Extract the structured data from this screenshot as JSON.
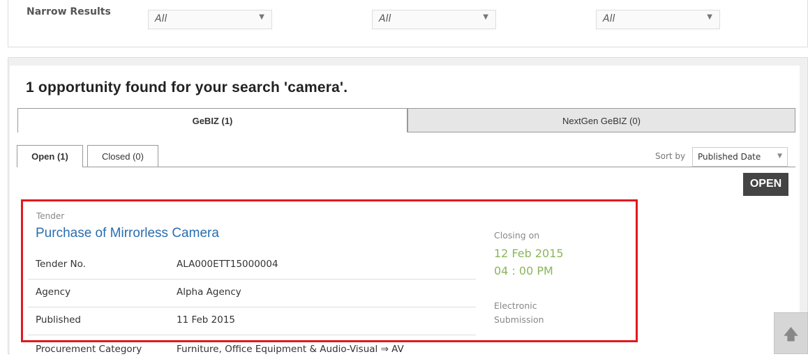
{
  "narrow": {
    "label": "Narrow Results",
    "filters": [
      {
        "value": "All"
      },
      {
        "value": "All"
      },
      {
        "value": "All"
      }
    ]
  },
  "results": {
    "summary": "1 opportunity found for your search 'camera'."
  },
  "source_tabs": [
    {
      "label": "GeBIZ (1)",
      "active": true
    },
    {
      "label": "NextGen GeBIZ (0)",
      "active": false
    }
  ],
  "status_tabs": [
    {
      "label": "Open (1)",
      "active": true
    },
    {
      "label": "Closed (0)",
      "active": false
    }
  ],
  "sort": {
    "label": "Sort by",
    "value": "Published Date"
  },
  "badge": "OPEN",
  "tender": {
    "type": "Tender",
    "title": "Purchase of Mirrorless Camera",
    "fields": [
      {
        "label": "Tender No.",
        "value": "ALA000ETT15000004"
      },
      {
        "label": "Agency",
        "value": "Alpha Agency"
      },
      {
        "label": "Published",
        "value": "11 Feb 2015"
      },
      {
        "label": "Procurement Category",
        "value": "Furniture, Office Equipment & Audio-Visual ⇒ AV"
      }
    ],
    "closing_label": "Closing on",
    "closing_date": "12 Feb 2015",
    "closing_time": "04 : 00 PM",
    "submission": "Electronic Submission"
  },
  "icons": {
    "caret": "caret-down-icon",
    "scroll": "arrow-up-icon"
  },
  "colors": {
    "link": "#2a6db0",
    "closing": "#8ab55a",
    "highlight": "#e0191e",
    "badge": "#444444"
  }
}
